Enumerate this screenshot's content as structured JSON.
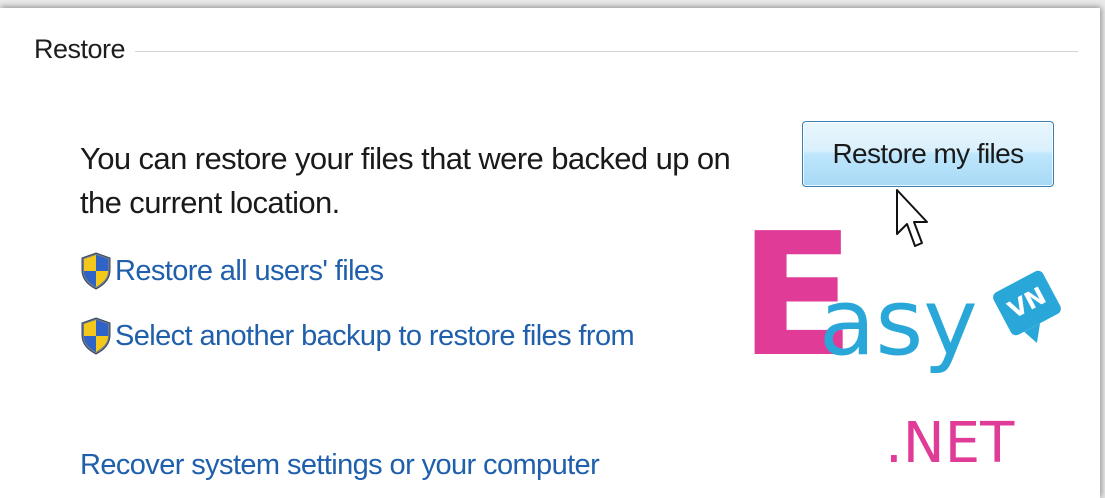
{
  "section": {
    "title": "Restore"
  },
  "description": "You can restore your files that were backed up on the current location.",
  "links": {
    "restore_all": "Restore all users' files",
    "select_backup": "Select another backup to restore files from",
    "recover_system": "Recover system settings or your computer"
  },
  "button": {
    "restore_label": "Restore my files"
  },
  "watermark": {
    "letter": "E",
    "text": "asy",
    "badge": "VN",
    "suffix": ".NET"
  },
  "colors": {
    "link": "#1f5fab",
    "button_border": "#3c7fb1",
    "watermark_pink": "#e03c97",
    "watermark_blue": "#2aa7d9"
  },
  "icons": {
    "uac_shield": "uac-shield-icon",
    "cursor": "mouse-pointer-icon"
  }
}
